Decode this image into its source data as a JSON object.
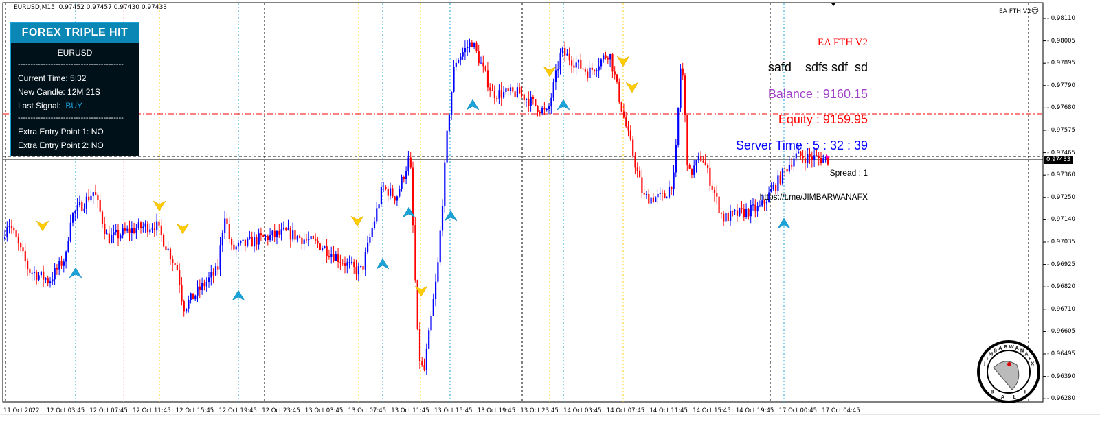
{
  "header": {
    "symbol_tf": "EURUSD,M15",
    "ohlc": "0.97452 0.97457 0.97430 0.97433"
  },
  "panel": {
    "title": "FOREX TRIPLE HIT",
    "symbol": "EURUSD",
    "separator": "------------------------------------------",
    "current_time": "Current Time: 5:32",
    "new_candle": "New Candle: 12M 21S",
    "last_signal_label": "Last Signal:",
    "last_signal_value": "BUY",
    "extra1": "Extra Entry Point 1:  NO",
    "extra2": "Extra Entry Point 2:  NO"
  },
  "ea": {
    "corner_label": "EA FTH V2",
    "smiley": "☺",
    "title": "EA FTH V2",
    "text_line": "safd    sdfs sdf  sd",
    "balance": "Balance : 9160.15",
    "equity": "Equity : 9159.95",
    "server_time": "Server Time : 5 : 32 : 39",
    "spread": "Spread : 1",
    "link": "https://t.me/JIMBARWANAFX"
  },
  "colors": {
    "bull": "#0000ff",
    "bear": "#ff0000",
    "buy_arrow": "#1aa3d8",
    "sell_arrow": "#ffcc00",
    "balance": "#a040c8",
    "equity": "#ff0000",
    "server_time": "#0000ff",
    "panel_bg": "#00111a",
    "panel_title": "#0a87b5"
  },
  "price_axis": [
    "0.98110",
    "0.98005",
    "0.97895",
    "0.97790",
    "0.97680",
    "0.97575",
    "0.97465",
    "0.97360",
    "0.97250",
    "0.97140",
    "0.97035",
    "0.96925",
    "0.96820",
    "0.96710",
    "0.96605",
    "0.96495",
    "0.96390",
    "0.96280"
  ],
  "current_price": "0.97433",
  "time_axis": [
    "11 Oct 2022",
    "12 Oct 03:45",
    "12 Oct 07:45",
    "12 Oct 11:45",
    "12 Oct 15:45",
    "12 Oct 19:45",
    "12 Oct 23:45",
    "13 Oct 03:45",
    "13 Oct 07:45",
    "13 Oct 11:45",
    "13 Oct 15:45",
    "13 Oct 19:45",
    "13 Oct 23:45",
    "14 Oct 03:45",
    "14 Oct 07:45",
    "14 Oct 11:45",
    "14 Oct 15:45",
    "14 Oct 19:45",
    "17 Oct 00:45",
    "17 Oct 04:45"
  ],
  "logo": {
    "ring_text": "JIMBARWANAFX",
    "bottom_text": "BALI"
  }
}
